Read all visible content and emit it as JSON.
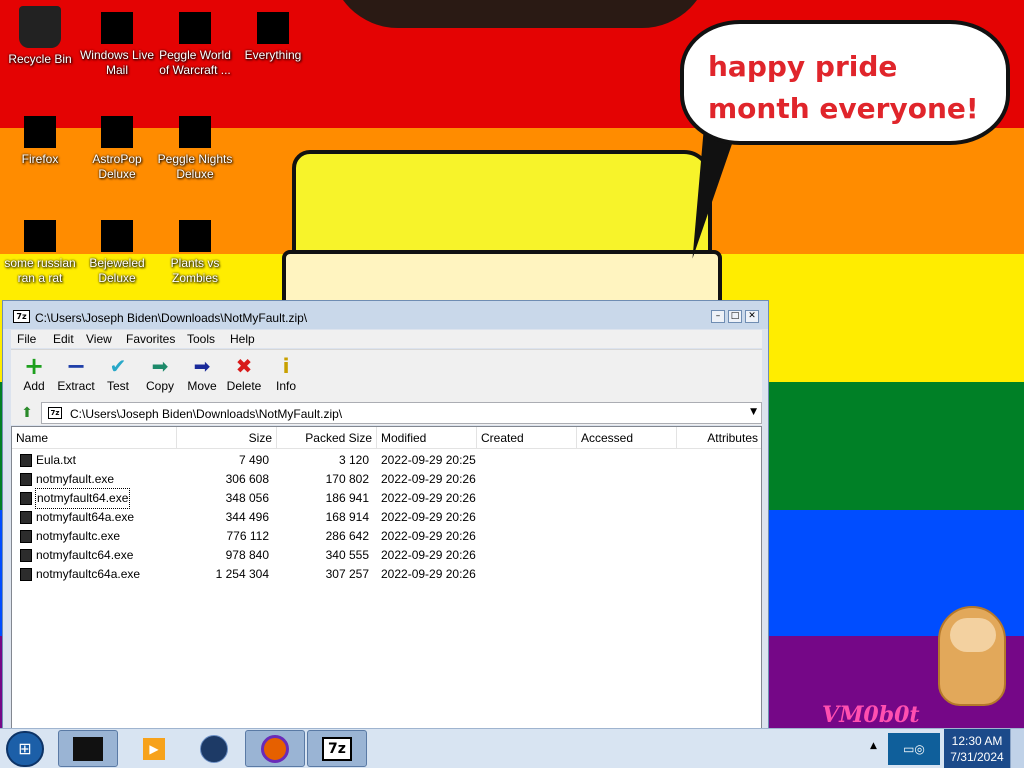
{
  "desktop": {
    "speech_bubble": "happy pride month everyone!",
    "watermark": "VM0b0t",
    "icons": [
      {
        "label": "Recycle Bin"
      },
      {
        "label": "Windows Live Mail"
      },
      {
        "label": "Peggle World of Warcraft ..."
      },
      {
        "label": "Everything"
      },
      {
        "label": "Firefox"
      },
      {
        "label": "AstroPop Deluxe"
      },
      {
        "label": "Peggle Nights Deluxe"
      },
      {
        "label": "some russian ran a rat"
      },
      {
        "label": "Bejeweled Deluxe"
      },
      {
        "label": "Plants vs Zombies"
      }
    ]
  },
  "window": {
    "title": "C:\\Users\\Joseph Biden\\Downloads\\NotMyFault.zip\\",
    "app_icon": "7z",
    "menu": [
      "File",
      "Edit",
      "View",
      "Favorites",
      "Tools",
      "Help"
    ],
    "toolbar": [
      {
        "label": "Add",
        "icon": "plus-icon"
      },
      {
        "label": "Extract",
        "icon": "minus-icon"
      },
      {
        "label": "Test",
        "icon": "checkmark-icon"
      },
      {
        "label": "Copy",
        "icon": "copy-arrow-icon"
      },
      {
        "label": "Move",
        "icon": "move-arrow-icon"
      },
      {
        "label": "Delete",
        "icon": "delete-x-icon"
      },
      {
        "label": "Info",
        "icon": "info-icon"
      }
    ],
    "address": "C:\\Users\\Joseph Biden\\Downloads\\NotMyFault.zip\\",
    "columns": [
      "Name",
      "Size",
      "Packed Size",
      "Modified",
      "Created",
      "Accessed",
      "Attributes"
    ],
    "files": [
      {
        "name": "Eula.txt",
        "size": "7 490",
        "packed": "3 120",
        "modified": "2022-09-29 20:25"
      },
      {
        "name": "notmyfault.exe",
        "size": "306 608",
        "packed": "170 802",
        "modified": "2022-09-29 20:26"
      },
      {
        "name": "notmyfault64.exe",
        "size": "348 056",
        "packed": "186 941",
        "modified": "2022-09-29 20:26"
      },
      {
        "name": "notmyfault64a.exe",
        "size": "344 496",
        "packed": "168 914",
        "modified": "2022-09-29 20:26"
      },
      {
        "name": "notmyfaultc.exe",
        "size": "776 112",
        "packed": "286 642",
        "modified": "2022-09-29 20:26"
      },
      {
        "name": "notmyfaultc64.exe",
        "size": "978 840",
        "packed": "340 555",
        "modified": "2022-09-29 20:26"
      },
      {
        "name": "notmyfaultc64a.exe",
        "size": "1 254 304",
        "packed": "307 257",
        "modified": "2022-09-29 20:26"
      }
    ]
  },
  "taskbar": {
    "time": "12:30 AM",
    "date": "7/31/2024",
    "active_app": "7z"
  },
  "colors": {
    "wallpaper_red": "#e40303",
    "wallpaper_orange": "#ff8c00",
    "wallpaper_yellow": "#ffed00",
    "wallpaper_green": "#008026",
    "wallpaper_blue": "#004dff",
    "wallpaper_purple": "#750787",
    "speech_text": "#e0252b"
  }
}
